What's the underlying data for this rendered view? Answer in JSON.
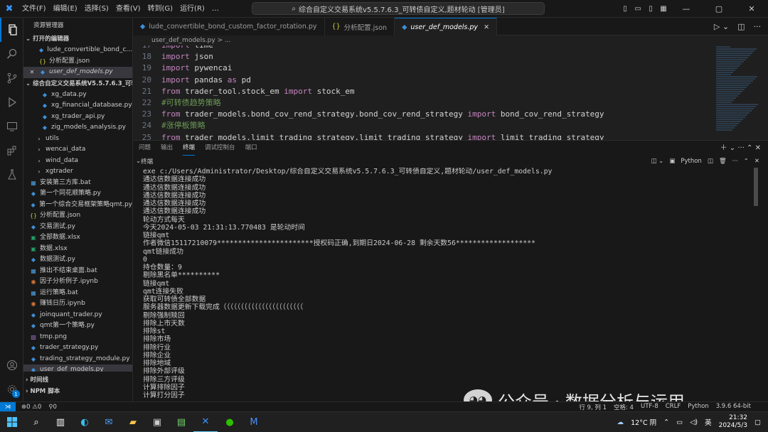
{
  "titlebar": {
    "logo": "⨉",
    "menu": [
      "文件(F)",
      "编辑(E)",
      "选择(S)",
      "查看(V)",
      "转到(G)",
      "运行(R)",
      "…"
    ],
    "search": "综合自定义交易系统v5.5.7.6.3_可转债自定义,题材轮动 [管理员]"
  },
  "sidebar": {
    "header": "资源管理器",
    "open_editors_title": "打开的编辑器",
    "open_editors": [
      {
        "name": "lude_convertible_bond_c...",
        "icon": "py"
      },
      {
        "name": "分析配置.json",
        "icon": "json"
      },
      {
        "name": "user_def_models.py",
        "icon": "py",
        "selected": true
      }
    ],
    "folder_title": "综合自定义交易系统V5.5.7.6.3_可转...",
    "files": [
      {
        "name": "xg_data.py",
        "icon": "py",
        "indent": 2
      },
      {
        "name": "xg_financial_database.py",
        "icon": "py",
        "indent": 2
      },
      {
        "name": "xg_trader_api.py",
        "icon": "py",
        "indent": 2
      },
      {
        "name": "zig_models_analysis.py",
        "icon": "py",
        "indent": 2
      },
      {
        "name": "utils",
        "icon": "folder",
        "indent": 1
      },
      {
        "name": "wencai_data",
        "icon": "folder",
        "indent": 1
      },
      {
        "name": "wind_data",
        "icon": "folder",
        "indent": 1
      },
      {
        "name": "xgtrader",
        "icon": "folder",
        "indent": 1
      },
      {
        "name": "安装第三方库.bat",
        "icon": "bat",
        "indent": 0
      },
      {
        "name": "第一个同花顺策略.py",
        "icon": "py",
        "indent": 0
      },
      {
        "name": "第一个综合交易框架策略qmt.py",
        "icon": "py",
        "indent": 0
      },
      {
        "name": "分析配置.json",
        "icon": "json",
        "indent": 0
      },
      {
        "name": "交易测试.py",
        "icon": "py",
        "indent": 0
      },
      {
        "name": "全部数据.xlsx",
        "icon": "xls",
        "indent": 0
      },
      {
        "name": "数据.xlsx",
        "icon": "xls",
        "indent": 0
      },
      {
        "name": "数据测试.py",
        "icon": "py",
        "indent": 0
      },
      {
        "name": "推出不结束桌面.bat",
        "icon": "bat",
        "indent": 0
      },
      {
        "name": "因子分析例子.ipynb",
        "icon": "nb",
        "indent": 0
      },
      {
        "name": "运行策略.bat",
        "icon": "bat",
        "indent": 0
      },
      {
        "name": "赚钱日历.ipynb",
        "icon": "nb",
        "indent": 0
      },
      {
        "name": "joinquant_trader.py",
        "icon": "py",
        "indent": 0
      },
      {
        "name": "qmt第一个策略.py",
        "icon": "py",
        "indent": 0
      },
      {
        "name": "tmp.png",
        "icon": "png",
        "indent": 0
      },
      {
        "name": "trader_strategy.py",
        "icon": "py",
        "indent": 0
      },
      {
        "name": "trading_strategy_module.py",
        "icon": "py",
        "indent": 0
      },
      {
        "name": "user_def_models.py",
        "icon": "py",
        "indent": 0,
        "selected": true
      }
    ],
    "timeline": "时间线",
    "npm": "NPM 脚本"
  },
  "tabs": [
    {
      "label": "lude_convertible_bond_custom_factor_rotation.py",
      "icon": "py",
      "active": false
    },
    {
      "label": "分析配置.json",
      "icon": "json",
      "active": false
    },
    {
      "label": "user_def_models.py",
      "icon": "py",
      "active": true
    }
  ],
  "breadcrumb": "user_def_models.py > ...",
  "editor": {
    "lines": [
      {
        "n": "17",
        "parts": [
          [
            "kw",
            "import"
          ],
          [
            "plain",
            " time"
          ]
        ]
      },
      {
        "n": "18",
        "parts": [
          [
            "kw",
            "import"
          ],
          [
            "plain",
            " json"
          ]
        ]
      },
      {
        "n": "19",
        "parts": [
          [
            "kw",
            "import"
          ],
          [
            "plain",
            " pywencai"
          ]
        ]
      },
      {
        "n": "20",
        "parts": [
          [
            "kw",
            "import"
          ],
          [
            "plain",
            " pandas "
          ],
          [
            "kw",
            "as"
          ],
          [
            "plain",
            " pd"
          ]
        ]
      },
      {
        "n": "21",
        "parts": [
          [
            "kw",
            "from"
          ],
          [
            "plain",
            " trader_tool.stock_em "
          ],
          [
            "kw",
            "import"
          ],
          [
            "plain",
            " stock_em"
          ]
        ]
      },
      {
        "n": "22",
        "parts": [
          [
            "cmt",
            "#可转债趋势策略"
          ]
        ]
      },
      {
        "n": "23",
        "parts": [
          [
            "kw",
            "from"
          ],
          [
            "plain",
            " trader_models.bond_cov_rend_strategy.bond_cov_rend_strategy "
          ],
          [
            "kw",
            "import"
          ],
          [
            "plain",
            " bond_cov_rend_strategy"
          ]
        ]
      },
      {
        "n": "24",
        "parts": [
          [
            "cmt",
            "#涨停板策略"
          ]
        ]
      },
      {
        "n": "25",
        "parts": [
          [
            "kw",
            "from"
          ],
          [
            "plain",
            " trader_models.limit_trading_strategy.limit_trading_strategy "
          ],
          [
            "kw",
            "import"
          ],
          [
            "plain",
            " limit_trading_strategy"
          ]
        ]
      }
    ]
  },
  "panel": {
    "tabs": [
      "问题",
      "输出",
      "终端",
      "调试控制台",
      "端口"
    ],
    "active_tab": "终端",
    "terminal_label": "终端",
    "shell": "Python"
  },
  "terminal_lines": [
    "exe c:/Users/Administrator/Desktop/综合自定义交易系统v5.5.7.6.3_可转债自定义,题材轮动/user_def_models.py",
    "通达信数据连接成功",
    "通达信数据连接成功",
    "通达信数据连接成功",
    "通达信数据连接成功",
    "通达信数据连接成功",
    "轮动方式每天",
    "今天2024-05-03 21:31:13.770483 是轮动时间",
    "链接qmt",
    "作者微信15117210079***********************授权码正确,到期日2024-06-28 剩余天数56*******************",
    "qmt链接成功",
    "0",
    "持仓数量：9",
    "剔除黑名单**********",
    "链接qmt",
    "qmt连接失败",
    "获取可转债全部数据",
    "服务器数据更新下载完成（（（（（（（（（（（（（（（（（（（（（（（",
    "剔除强制赎回",
    "排除上市天数",
    "排除st",
    "排除市场",
    "排除行业",
    "排除企业",
    "排除地域",
    "排除外部评级",
    "排除三方评级",
    "计算排除因子",
    "计算打分因子"
  ],
  "watermark": {
    "text": "公众号 · 数据分析与运用"
  },
  "statusbar": {
    "problems": "⊗0 ⚠0",
    "ports": "⚲0",
    "position": "行 9, 列 1",
    "spaces": "空格: 4",
    "encoding": "UTF-8",
    "eol": "CRLF",
    "lang": "Python",
    "version": "3.9.6 64-bit"
  },
  "taskbar": {
    "weather": "12°C 阴",
    "ime": "英",
    "time": "21:32",
    "date": "2024/5/3"
  }
}
